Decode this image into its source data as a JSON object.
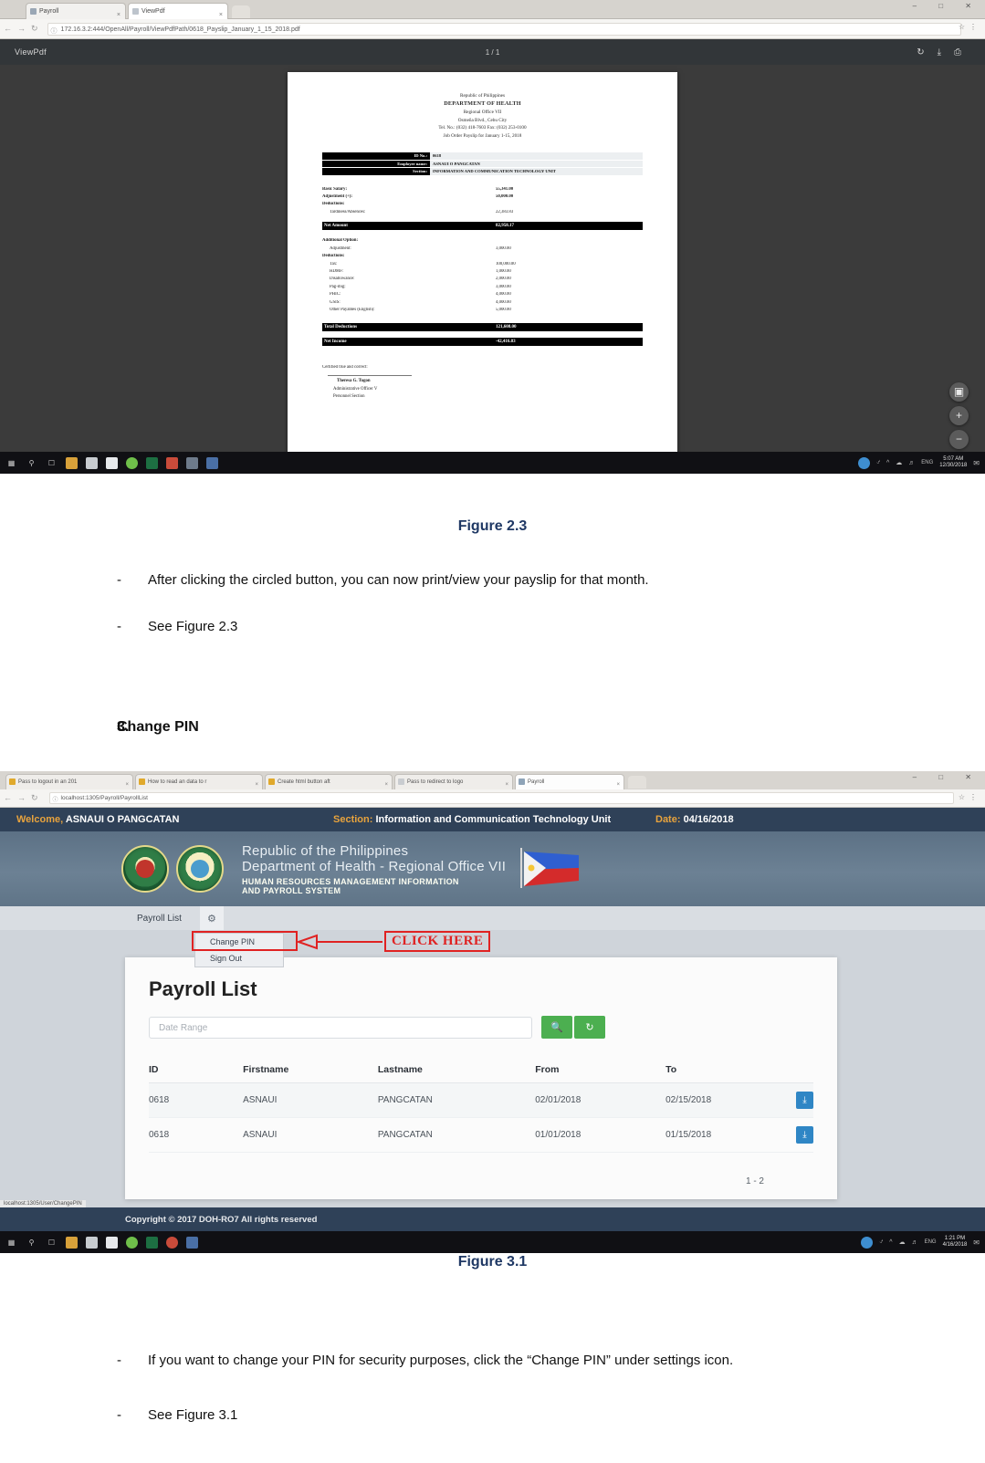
{
  "figure23": {
    "browser": {
      "tabs": [
        {
          "label": "Payroll"
        },
        {
          "label": "ViewPdf"
        }
      ],
      "url": "172.16.3.2:444/OpenAll/Payroll/ViewPdfPath/0618_Payslip_January_1_15_2018.pdf",
      "window_controls": "– □ ✕",
      "url_lock_icon": "info-icon"
    },
    "pdf_viewer": {
      "title": "ViewPdf",
      "page_indicator": "1 / 1",
      "toolbar_icons": [
        "rotate-icon",
        "download-icon",
        "print-icon"
      ],
      "zoom_controls": [
        "fit-icon",
        "zoom-in-icon",
        "zoom-out-icon"
      ]
    },
    "payslip": {
      "header_lines": [
        "Republic of Philippines",
        "DEPARTMENT OF HEALTH",
        "Regional Office VII",
        "Osmeña Blvd., Cebu City",
        "Tel. No.: (032) 418-7603 Fax: (032) 253-0100"
      ],
      "subtitle": "Job Order Payslip for January 1-15, 2018",
      "id_rows": [
        {
          "label": "ID No.:",
          "value": "0618"
        },
        {
          "label": "Employee name:",
          "value": "ASNAUI O PANGCATAN"
        },
        {
          "label": "Section:",
          "value": "INFORMATION AND COMMUNICATION TECHNOLOGY UNIT"
        }
      ],
      "earnings": [
        {
          "name": "Basic Salary:",
          "amount": "55,341.00"
        },
        {
          "name": "Adjustment (+):",
          "amount": "50,000.00"
        }
      ],
      "deductions_label": "Deductions:",
      "deductions_top": [
        {
          "name": "Tardiness/Absences:",
          "amount": "22,383.83"
        }
      ],
      "net_amount": {
        "name": "Net Amount",
        "amount": "82,958.17"
      },
      "additional_option_label": "Additional Option:",
      "adjustment": {
        "name": "Adjustment:",
        "amount": "3,000.00"
      },
      "deductions2_label": "Deductions:",
      "deductions2": [
        {
          "name": "Tax:",
          "amount": "100,000.00"
        },
        {
          "name": "HDMF:",
          "amount": "1,000.00"
        },
        {
          "name": "Disallowance:",
          "amount": "2,000.00"
        },
        {
          "name": "Pag-ibig:",
          "amount": "3,000.00"
        },
        {
          "name": "PHIC:",
          "amount": "4,000.00"
        },
        {
          "name": "GSIS:",
          "amount": "4,000.00"
        },
        {
          "name": "Other Payables (English):",
          "amount": "5,000.00"
        }
      ],
      "total_deductions": {
        "name": "Total Deductions",
        "amount": "121,608.00"
      },
      "net_income": {
        "name": "Net Income",
        "amount": "-42,416.83"
      },
      "certify_text": "Certified true and correct:",
      "certify_name": "Theresa G. Tugon",
      "certify_title": "Administrative Officer V",
      "certify_dept": "Personnel Section"
    },
    "taskbar": {
      "icons": [
        "windows-icon",
        "search-icon",
        "taskview-icon",
        "folder-icon",
        "briefcase-icon",
        "mail-icon",
        "chrome-icon",
        "excel-icon",
        "pdf-icon",
        "calendar-icon",
        "app-icon"
      ],
      "tray_icons": [
        "chrome-icon",
        "bluetooth-icon",
        "chevron-up-icon",
        "network-icon",
        "volume-icon",
        "eng-icon"
      ],
      "time": "5:07 AM",
      "date": "12/30/2018"
    }
  },
  "caption23": "Figure 2.3",
  "bullets23": [
    {
      "dash": "-",
      "text": "After clicking the circled button, you can now print/view your payslip for that month."
    },
    {
      "dash": "-",
      "text": "See Figure 2.3"
    }
  ],
  "section3": {
    "number": "3.",
    "title": "Change PIN"
  },
  "figure31": {
    "browser": {
      "tabs": [
        {
          "label": "Pass to logout in an 201"
        },
        {
          "label": "How to read an data to r"
        },
        {
          "label": "Create html button aft"
        },
        {
          "label": "Pass to redirect to logo"
        },
        {
          "label": "Payroll"
        }
      ],
      "url": "localhost:1305/Payroll/PayrollList",
      "window_controls": "– □ ✕"
    },
    "topbar": {
      "welcome_label": "Welcome,",
      "welcome_user": "ASNAUI O PANGCATAN",
      "section_label": "Section:",
      "section_value": "Information and Communication Technology Unit",
      "date_label": "Date:",
      "date_value": "04/16/2018"
    },
    "banner": {
      "line1": "Republic of the Philippines",
      "line2": "Department of Health - Regional Office VII",
      "line3": "HUMAN RESOURCES MANAGEMENT INFORMATION",
      "line4": "AND PAYROLL SYSTEM",
      "seal_left": "doh-seal-icon",
      "seal_right": "agency-seal-icon",
      "flag": "philippine-flag-icon"
    },
    "nav": {
      "tab_label": "Payroll List",
      "gear_icon": "gear-icon"
    },
    "dropdown": {
      "items": [
        "Change PIN",
        "Sign Out"
      ]
    },
    "annotation": {
      "click_here": "CLICK HERE",
      "arrow": "left-arrow-annotation",
      "highlight_color": "#e02222"
    },
    "page": {
      "title": "Payroll List",
      "date_range_placeholder": "Date Range",
      "date_range_value": "",
      "search_icon": "search-icon",
      "refresh_icon": "refresh-icon",
      "columns": [
        "ID",
        "Firstname",
        "Lastname",
        "From",
        "To",
        ""
      ],
      "rows": [
        {
          "id": "0618",
          "firstname": "ASNAUI",
          "lastname": "PANGCATAN",
          "from": "02/01/2018",
          "to": "02/15/2018",
          "action": "download-icon"
        },
        {
          "id": "0618",
          "firstname": "ASNAUI",
          "lastname": "PANGCATAN",
          "from": "01/01/2018",
          "to": "01/15/2018",
          "action": "download-icon"
        }
      ],
      "pager": "1 - 2"
    },
    "footer": "Copyright © 2017 DOH-RO7 All rights reserved",
    "statusbar": "localhost:1305/User/ChangePIN",
    "taskbar": {
      "time": "1:21 PM",
      "date": "4/16/2018"
    }
  },
  "caption31": "Figure 3.1",
  "bullets31": [
    {
      "dash": "-",
      "text": "If you want to change your PIN for security purposes, click the “Change PIN” under settings icon."
    },
    {
      "dash": "-",
      "text": "See Figure 3.1"
    }
  ]
}
